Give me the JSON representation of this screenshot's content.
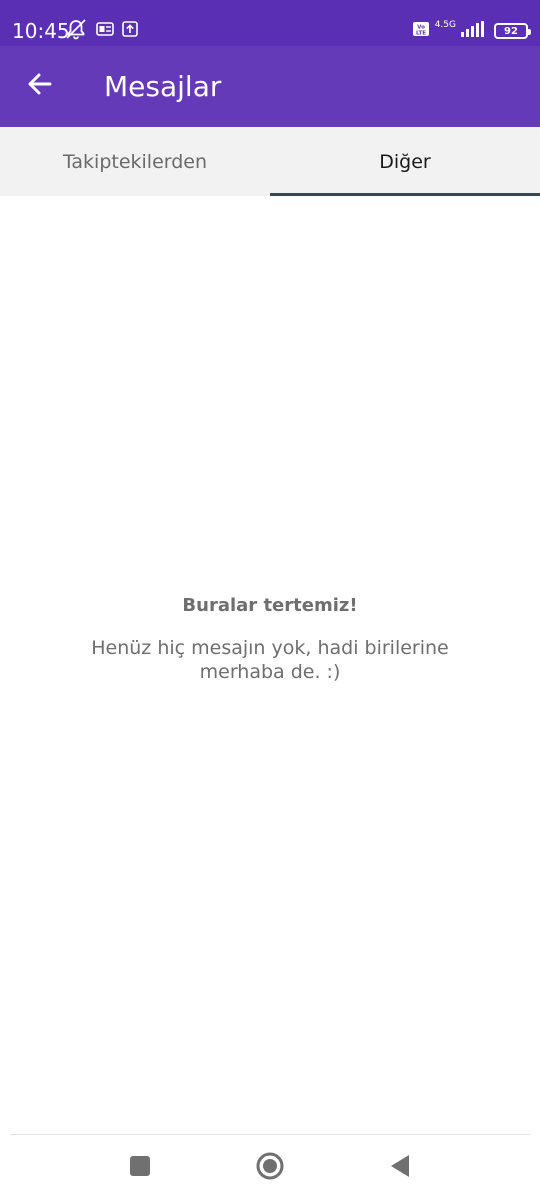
{
  "status_bar": {
    "time": "10:45",
    "network": "4.5G",
    "volte": "Vo LTE",
    "battery_level": "92",
    "icons": [
      "alarm-off-icon",
      "notification-icon",
      "upload-icon",
      "volte-icon",
      "signal-icon",
      "battery-icon"
    ]
  },
  "app_bar": {
    "back_icon": "arrow-left-icon",
    "title": "Mesajlar"
  },
  "tabs": [
    {
      "label": "Takiptekilerden",
      "active": false
    },
    {
      "label": "Diğer",
      "active": true
    }
  ],
  "empty_state": {
    "title": "Buralar tertemiz!",
    "subtitle": "Henüz hiç mesajın yok, hadi birilerine merhaba de. :)"
  },
  "nav_bar": {
    "buttons": [
      "recent-apps-icon",
      "home-icon",
      "back-icon"
    ]
  },
  "colors": {
    "status_bar": "#5a2fb3",
    "app_bar": "#653ab9",
    "tab_bar": "#f2f2f2",
    "tab_indicator": "#37474f",
    "empty_text": "#6e6e6e"
  }
}
